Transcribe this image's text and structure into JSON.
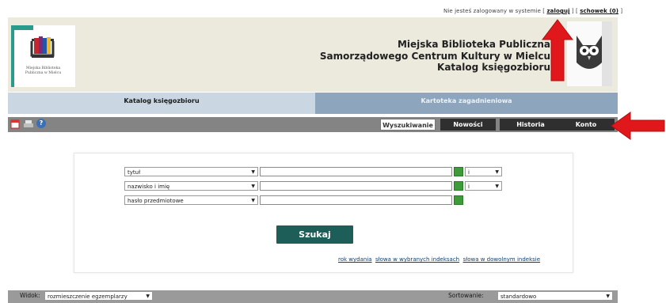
{
  "status": {
    "prefix": "Nie jesteś zalogowany w systemie [",
    "login": "zaloguj",
    "middle": "] [",
    "cart": "schowek (0)",
    "suffix": "]"
  },
  "logo": {
    "caption_line1": "Miejska Biblioteka",
    "caption_line2": "Publiczna w Mielcu"
  },
  "header": {
    "line1": "Miejska Biblioteka Publiczna",
    "line2": "Samorządowego Centrum Kultury w Mielcu",
    "line3": "Katalog księgozbioru"
  },
  "main_tabs": [
    {
      "label": "Katalog księgozbioru",
      "active": true
    },
    {
      "label": "Kartoteka zagadnieniowa",
      "active": false
    }
  ],
  "toolbar": {
    "icons": [
      "new-window-icon",
      "print-icon",
      "help-icon"
    ],
    "help_glyph": "?",
    "tabs": [
      {
        "label": "Wyszukiwanie",
        "active": true
      },
      {
        "label": "Nowości",
        "active": false
      },
      {
        "label": "Historia",
        "active": false
      },
      {
        "label": "Konto",
        "active": false
      }
    ]
  },
  "search": {
    "rows": [
      {
        "field": "tytuł",
        "value": "",
        "operator": "i"
      },
      {
        "field": "nazwisko i imię",
        "value": "",
        "operator": "i"
      },
      {
        "field": "hasło przedmiotowe",
        "value": "",
        "operator": ""
      }
    ],
    "button": "Szukaj",
    "links": [
      "rok wydania",
      "słowa w wybranych indeksach",
      "słowa w dowolnym indeksie"
    ]
  },
  "bottom": {
    "view_label": "Widok:",
    "view_value": "rozmieszczenie egzemplarzy",
    "sort_label": "Sortowanie:",
    "sort_value": "standardowo"
  },
  "colors": {
    "header_bg": "#ece9dd",
    "tab_active": "#cad6e1",
    "tab_inactive": "#8da6bd",
    "toolbar": "#848484",
    "search_button": "#1e5e59",
    "annotation_arrow": "#e0181b"
  }
}
